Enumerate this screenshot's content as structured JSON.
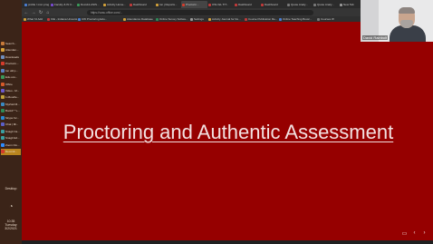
{
  "taskbar": {
    "items": [
      {
        "label": "Search...",
        "color": "#c77a3a"
      },
      {
        "label": "Attendan...",
        "color": "#d8a23a"
      },
      {
        "label": "Downloads",
        "color": "#6f8fbf"
      },
      {
        "label": "Proctorin...",
        "color": "#d43c2c"
      },
      {
        "label": "Ion util p...",
        "color": "#5a7fc2"
      },
      {
        "label": "Edu.ucs...",
        "color": "#3a9a5a"
      },
      {
        "label": "Office",
        "color": "#d65a2a"
      },
      {
        "label": "Video - M...",
        "color": "#6a5acd"
      },
      {
        "label": "1-Moodle...",
        "color": "#c2a23a"
      },
      {
        "label": "MyZoid M...",
        "color": "#3a8ac2"
      },
      {
        "label": "Book1* *+...",
        "color": "#2e8b57"
      },
      {
        "label": "Skype for...",
        "color": "#2a8ad4"
      },
      {
        "label": "Chat | Mi...",
        "color": "#5b5fc7"
      },
      {
        "label": "Snagit Ca...",
        "color": "#3aa0a0"
      },
      {
        "label": "Snagit Ed...",
        "color": "#3aa0a0"
      },
      {
        "label": "Zoom Clo...",
        "color": "#2d8cff"
      },
      {
        "label": "Recordi...",
        "color": "#d43c2c"
      }
    ],
    "bottom": {
      "label1": "Desktop",
      "time": "10:35",
      "day": "Tuesday",
      "date": "3/2/2021"
    }
  },
  "tabs": [
    {
      "label": "profile / msn progr...",
      "color": "#4a7fd4"
    },
    {
      "label": "Faculty & IN C...",
      "color": "#7a4ad4"
    },
    {
      "label": "Docs12-ASIS...",
      "color": "#3a9a5a"
    },
    {
      "label": "Activity Home...",
      "color": "#d4a23a"
    },
    {
      "label": "Dashboard",
      "color": "#c23a3a"
    },
    {
      "label": "Ion j Reports...",
      "color": "#d4a23a"
    },
    {
      "label": "Proctorin...",
      "color": "#d43c2c"
    },
    {
      "label": "OSU EL TIT...",
      "color": "#c23a3a"
    },
    {
      "label": "Dashboard",
      "color": "#c23a3a"
    },
    {
      "label": "Dashboard",
      "color": "#c23a3a"
    },
    {
      "label": "Quote Analy...",
      "color": "#7a7a7a"
    },
    {
      "label": "Quote Analy...",
      "color": "#7a7a7a"
    },
    {
      "label": "New Tab",
      "color": "#9a9a9a"
    }
  ],
  "address": {
    "url": "https://ucsu.office.com/..."
  },
  "bookmarks": [
    {
      "label": "What I'd Add",
      "color": "#d4a23a"
    },
    {
      "label": "ICE - Indiana Universi...",
      "color": "#c23a3a"
    },
    {
      "label": "UW Proctoring Edu...",
      "color": "#4a7fd4"
    },
    {
      "label": "Attendance Database",
      "color": "#d4a23a"
    },
    {
      "label": "Online Survey Softwa...",
      "color": "#2e8b57"
    },
    {
      "label": "Settings",
      "color": "#9a9a9a"
    },
    {
      "label": "Activity Journal for Do...",
      "color": "#d4a23a"
    },
    {
      "label": "Course Publication Re...",
      "color": "#c23a3a"
    },
    {
      "label": "Online Teaching Bootc...",
      "color": "#4a7fd4"
    },
    {
      "label": "Courses W",
      "color": "#7a7a7a"
    }
  ],
  "slide": {
    "title": "Proctoring and Authentic Assessment"
  },
  "webcam": {
    "name": "David Rainbolt"
  },
  "colors": {
    "slide_bg": "#960000",
    "taskbar_bg": "#3b2418",
    "active_task": "#b8841e"
  }
}
